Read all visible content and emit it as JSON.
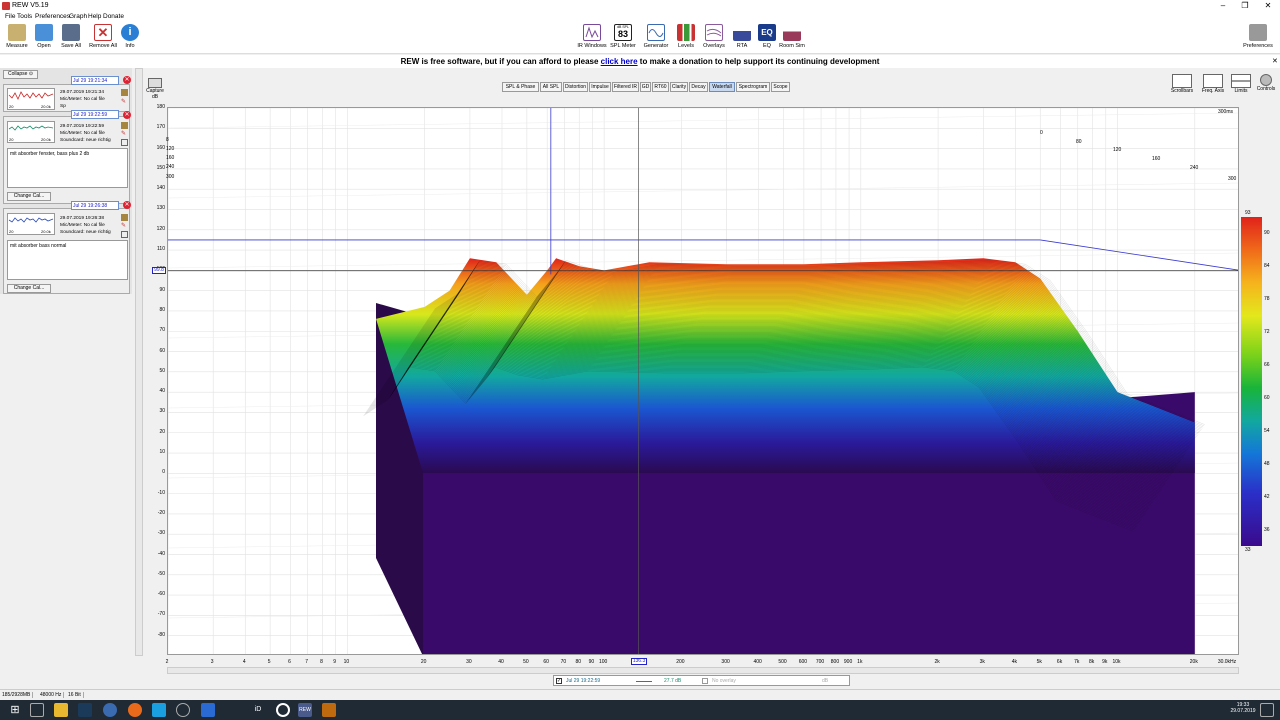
{
  "window": {
    "title": "REW V5.19",
    "min": "–",
    "max": "❐",
    "close": "✕"
  },
  "menu": [
    "File",
    "Tools",
    "Preferences",
    "Graph",
    "Help",
    "Donate"
  ],
  "toolbar_left": [
    {
      "label": "Measure",
      "icon": "measure-icon",
      "color": "#c8b070"
    },
    {
      "label": "Open",
      "icon": "folder-open-icon",
      "color": "#4a90d9"
    },
    {
      "label": "Save All",
      "icon": "save-all-icon",
      "color": "#5a6e8c"
    },
    {
      "label": "Remove All",
      "icon": "remove-all-icon",
      "color": "#c83232"
    },
    {
      "label": "Info",
      "icon": "info-icon",
      "color": "#2a7fd4"
    }
  ],
  "toolbar_center": [
    {
      "label": "IR Windows",
      "icon": "ir-windows-icon",
      "color": "#7a4a9a"
    },
    {
      "label": "SPL Meter",
      "icon": "spl-meter-icon",
      "color": "#222222",
      "value": "83",
      "sub": "dB SPL"
    },
    {
      "label": "Generator",
      "icon": "generator-icon",
      "color": "#3a6ab0"
    },
    {
      "label": "Levels",
      "icon": "levels-icon",
      "color": "#c83232"
    },
    {
      "label": "Overlays",
      "icon": "overlays-icon",
      "color": "#8a5a9a"
    },
    {
      "label": "RTA",
      "icon": "rta-icon",
      "color": "#3a4a9a"
    },
    {
      "label": "EQ",
      "icon": "eq-icon",
      "color": "#1a3a8a"
    },
    {
      "label": "Room Sim",
      "icon": "room-sim-icon",
      "color": "#9a3a5a"
    }
  ],
  "toolbar_right": {
    "label": "Preferences",
    "icon": "preferences-icon"
  },
  "banner": {
    "prefix": "REW is free software, but if you can afford to please ",
    "link": "click here",
    "suffix": " to make a donation to help support its continuing development"
  },
  "left_panel": {
    "collapse_label": "Collapse",
    "measurements": [
      {
        "date_field": "Jul 29 19:21:34",
        "line1": "29.07.2019 19:21:34",
        "line2": "Mic/Meter: No cal file",
        "line3": "Sp",
        "thumb_lo": "20",
        "thumb_hi": "20.0k",
        "trace_color": "#c82a2a",
        "notes": "",
        "change_cal": ""
      },
      {
        "date_field": "Jul 29 19:22:59",
        "line1": "29.07.2019 19:22:59",
        "line2": "Mic/Meter: No cal file",
        "line3": "Soundcard: neue richtig",
        "thumb_lo": "20",
        "thumb_hi": "20.0k",
        "trace_color": "#1a8a6a",
        "notes": "mit absorber fenster, bass plus 2 db",
        "change_cal": "Change Cal..."
      },
      {
        "date_field": "Jul 29 19:26:38",
        "line1": "29.07.2019 19:26:38",
        "line2": "Mic/Meter: No cal file",
        "line3": "Soundcard: neue richtig",
        "thumb_lo": "20",
        "thumb_hi": "20.0k",
        "trace_color": "#2a4ab0",
        "notes": "mit absorber bass normal",
        "change_cal": "Change Cal..."
      }
    ]
  },
  "capture": {
    "label": "Capture",
    "unit": "dB"
  },
  "graph_tabs": [
    {
      "label": "SPL & Phase",
      "selected": false
    },
    {
      "label": "All SPL",
      "selected": false
    },
    {
      "label": "Distortion",
      "selected": false
    },
    {
      "label": "Impulse",
      "selected": false
    },
    {
      "label": "Filtered IR",
      "selected": false
    },
    {
      "label": "GD",
      "selected": false
    },
    {
      "label": "RT60",
      "selected": false
    },
    {
      "label": "Clarity",
      "selected": false
    },
    {
      "label": "Decay",
      "selected": false
    },
    {
      "label": "Waterfall",
      "selected": true
    },
    {
      "label": "Spectrogram",
      "selected": false
    },
    {
      "label": "Scope",
      "selected": false
    }
  ],
  "right_controls": [
    {
      "label": "Scrollbars",
      "icon": "scrollbars-icon"
    },
    {
      "label": "Freq. Axis",
      "icon": "freq-axis-icon"
    },
    {
      "label": "Limits",
      "icon": "limits-icon"
    },
    {
      "label": "Controls",
      "icon": "controls-icon"
    }
  ],
  "chart_data": {
    "type": "waterfall",
    "y_unit": "dB",
    "y_ticks": [
      "180",
      "170",
      "160",
      "150",
      "140",
      "130",
      "120",
      "110",
      "100",
      "90",
      "80",
      "70",
      "60",
      "50",
      "40",
      "30",
      "20",
      "10",
      "0",
      "-10",
      "-20",
      "-30",
      "-40",
      "-50",
      "-60",
      "-70",
      "-80"
    ],
    "ylim": [
      -85,
      180
    ],
    "x_ticks": [
      "2",
      "3",
      "4",
      "5",
      "6",
      "7",
      "8",
      "9",
      "10",
      "20",
      "30",
      "40",
      "50",
      "60",
      "70",
      "80",
      "90",
      "100",
      "200",
      "300",
      "400",
      "500",
      "600",
      "700",
      "800",
      "900",
      "1k",
      "2k",
      "3k",
      "4k",
      "5k",
      "6k",
      "7k",
      "8k",
      "9k",
      "10k",
      "20k",
      "30.0kHz"
    ],
    "x_scale": "log",
    "xlim_hz": [
      2,
      30000
    ],
    "time_axis_ms": [
      "0",
      "80",
      "120",
      "160",
      "240",
      "300"
    ],
    "time_axis_end": "300ms",
    "time_axis_left": [
      "8",
      "120",
      "160",
      "240",
      "300"
    ],
    "cursor_y_readout": "99.8",
    "cursor_x_readout": "136.3",
    "colorbar_ticks": [
      "93",
      "90",
      "84",
      "78",
      "72",
      "66",
      "60",
      "54",
      "48",
      "42",
      "36",
      "33"
    ],
    "colorbar_range": [
      33,
      93
    ],
    "surface_profile": [
      {
        "hz": 20,
        "db": 82
      },
      {
        "hz": 25,
        "db": 90
      },
      {
        "hz": 30,
        "db": 106
      },
      {
        "hz": 38,
        "db": 104
      },
      {
        "hz": 50,
        "db": 88
      },
      {
        "hz": 60,
        "db": 100
      },
      {
        "hz": 65,
        "db": 106
      },
      {
        "hz": 80,
        "db": 102
      },
      {
        "hz": 100,
        "db": 100
      },
      {
        "hz": 150,
        "db": 104
      },
      {
        "hz": 300,
        "db": 103
      },
      {
        "hz": 600,
        "db": 103
      },
      {
        "hz": 1000,
        "db": 104
      },
      {
        "hz": 2000,
        "db": 105
      },
      {
        "hz": 3000,
        "db": 106
      },
      {
        "hz": 4000,
        "db": 104
      },
      {
        "hz": 5000,
        "db": 96
      },
      {
        "hz": 7000,
        "db": 70
      },
      {
        "hz": 10000,
        "db": 40
      },
      {
        "hz": 20000,
        "db": 25
      }
    ],
    "floor_db": 20
  },
  "legend_bar": {
    "name": "Jul 29 19:22:59",
    "value": "27.7 dB",
    "overlay": "No overlay",
    "overlay_unit": "dB"
  },
  "status": [
    "185/2928MB",
    "48000 Hz",
    "16 Bit"
  ],
  "taskbar": {
    "time": "19:33",
    "date": "29.07.2019",
    "apps": [
      "start",
      "search",
      "explorer",
      "steam",
      "chrome-old",
      "firefox",
      "chrome",
      "cpu",
      "vm",
      "id",
      "rec",
      "rew",
      "steam-alt"
    ]
  }
}
